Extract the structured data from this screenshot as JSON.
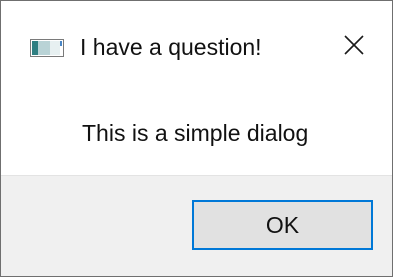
{
  "window": {
    "title": "I have a question!",
    "icon": "window-app-icon",
    "close_icon": "close-icon"
  },
  "dialog": {
    "message": "This is a simple dialog"
  },
  "footer": {
    "ok_label": "OK",
    "accent": "#0078d7"
  }
}
